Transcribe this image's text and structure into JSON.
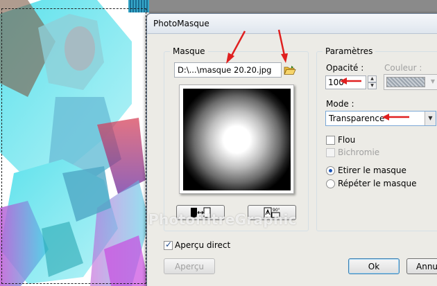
{
  "dialog": {
    "title": "PhotoMasque",
    "mask_group": {
      "title": "Masque",
      "path_value": "D:\\...\\masque 20.20.jpg"
    },
    "params_group": {
      "title": "Paramètres",
      "opacity_label": "Opacité :",
      "opacity_value": "100",
      "color_label": "Couleur :",
      "mode_label": "Mode :",
      "mode_value": "Transparence",
      "blur_label": "Flou",
      "bichromie_label": "Bichromie",
      "stretch_label": "Etirer le masque",
      "repeat_label": "Répéter le masque",
      "selected_option": "Etirer le masque"
    },
    "preview_direct_label": "Aperçu direct",
    "preview_direct_checked": true,
    "buttons": {
      "apercu": "Aperçu",
      "ok": "Ok",
      "cancel": "Annu"
    },
    "watermark": "PhotofiltreGraphic",
    "rotate_badge": "90°"
  },
  "colors": {
    "annotation_arrow": "#e02020",
    "dialog_bg": "#ecebe6"
  }
}
